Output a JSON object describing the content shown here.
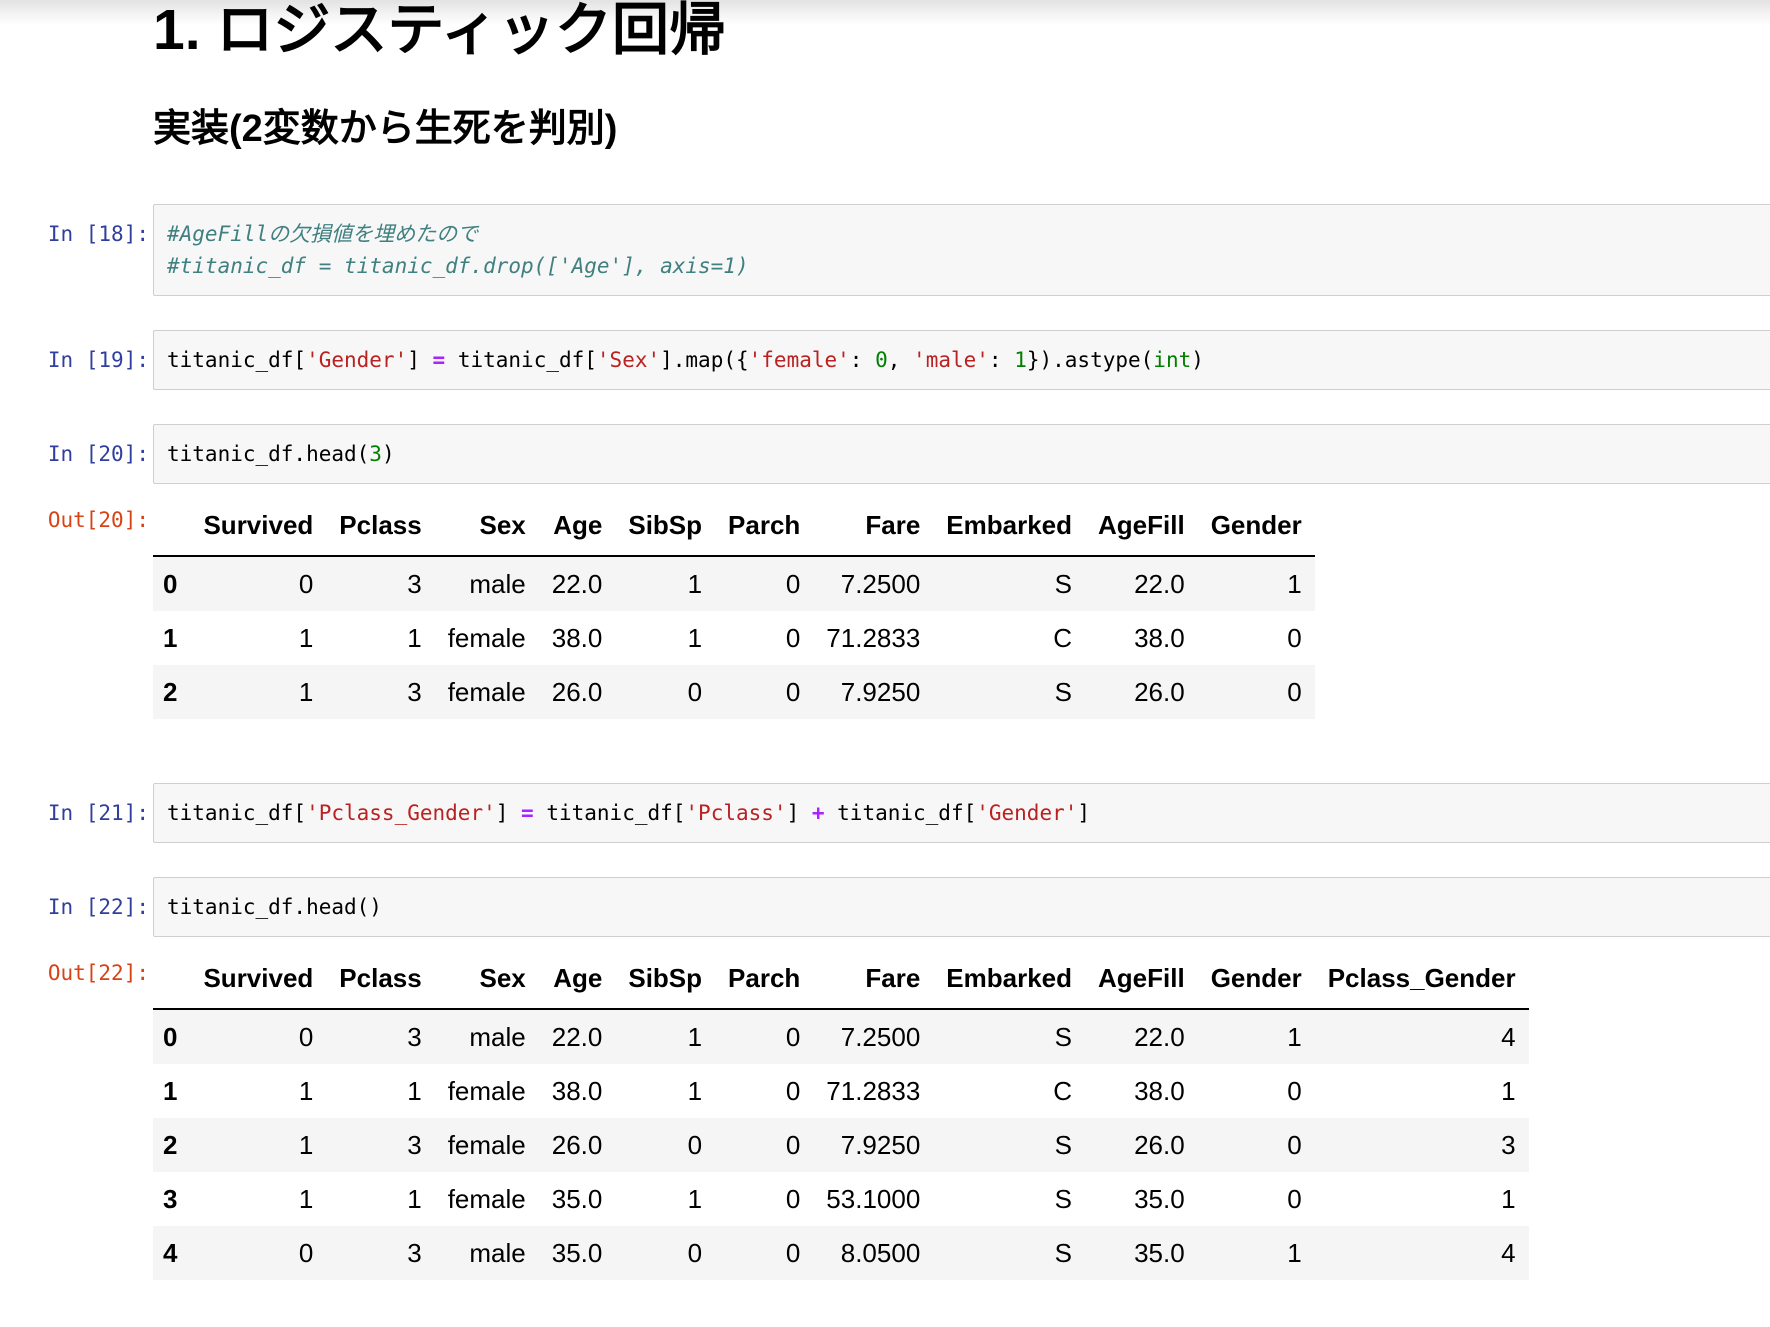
{
  "colors": {
    "input_prompt": "#303F9F",
    "output_prompt": "#D84315",
    "code_string": "#BA2121",
    "code_number": "#008000",
    "code_operator": "#AA22FF",
    "code_comment": "#408080",
    "cell_background": "#f7f7f7",
    "cell_border": "#cfcfcf",
    "table_stripe": "#f5f5f5"
  },
  "heading": {
    "h1": "1. ロジスティック回帰",
    "h3": "実装(2変数から生死を判別)"
  },
  "cell18": {
    "prompt": "In [18]:",
    "lines": [
      [
        [
          "comment",
          "#AgeFillの欠損値を埋めたので"
        ]
      ],
      [
        [
          "comment",
          "#titanic_df = titanic_df.drop(['Age'], axis=1)"
        ]
      ]
    ]
  },
  "cell19": {
    "prompt": "In [19]:",
    "lines": [
      [
        [
          "plain",
          "titanic_df["
        ],
        [
          "string",
          "'Gender'"
        ],
        [
          "plain",
          "] "
        ],
        [
          "operator",
          "="
        ],
        [
          "plain",
          " titanic_df["
        ],
        [
          "string",
          "'Sex'"
        ],
        [
          "plain",
          "].map({"
        ],
        [
          "string",
          "'female'"
        ],
        [
          "plain",
          ": "
        ],
        [
          "number",
          "0"
        ],
        [
          "plain",
          ", "
        ],
        [
          "string",
          "'male'"
        ],
        [
          "plain",
          ": "
        ],
        [
          "number",
          "1"
        ],
        [
          "plain",
          "}).astype("
        ],
        [
          "builtin",
          "int"
        ],
        [
          "plain",
          ")"
        ]
      ]
    ]
  },
  "cell20": {
    "prompt": "In [20]:",
    "lines": [
      [
        [
          "plain",
          "titanic_df.head("
        ],
        [
          "number",
          "3"
        ],
        [
          "plain",
          ")"
        ]
      ]
    ]
  },
  "out20": {
    "prompt": "Out[20]:",
    "table": {
      "columns": [
        "Survived",
        "Pclass",
        "Sex",
        "Age",
        "SibSp",
        "Parch",
        "Fare",
        "Embarked",
        "AgeFill",
        "Gender"
      ],
      "rows": [
        [
          "0",
          "0",
          "3",
          "male",
          "22.0",
          "1",
          "0",
          "7.2500",
          "S",
          "22.0",
          "1"
        ],
        [
          "1",
          "1",
          "1",
          "female",
          "38.0",
          "1",
          "0",
          "71.2833",
          "C",
          "38.0",
          "0"
        ],
        [
          "2",
          "1",
          "3",
          "female",
          "26.0",
          "0",
          "0",
          "7.9250",
          "S",
          "26.0",
          "0"
        ]
      ]
    }
  },
  "cell21": {
    "prompt": "In [21]:",
    "lines": [
      [
        [
          "plain",
          "titanic_df["
        ],
        [
          "string",
          "'Pclass_Gender'"
        ],
        [
          "plain",
          "] "
        ],
        [
          "operator",
          "="
        ],
        [
          "plain",
          " titanic_df["
        ],
        [
          "string",
          "'Pclass'"
        ],
        [
          "plain",
          "] "
        ],
        [
          "operator",
          "+"
        ],
        [
          "plain",
          " titanic_df["
        ],
        [
          "string",
          "'Gender'"
        ],
        [
          "plain",
          "]"
        ]
      ]
    ]
  },
  "cell22": {
    "prompt": "In [22]:",
    "lines": [
      [
        [
          "plain",
          "titanic_df.head()"
        ]
      ]
    ]
  },
  "out22": {
    "prompt": "Out[22]:",
    "table": {
      "columns": [
        "Survived",
        "Pclass",
        "Sex",
        "Age",
        "SibSp",
        "Parch",
        "Fare",
        "Embarked",
        "AgeFill",
        "Gender",
        "Pclass_Gender"
      ],
      "rows": [
        [
          "0",
          "0",
          "3",
          "male",
          "22.0",
          "1",
          "0",
          "7.2500",
          "S",
          "22.0",
          "1",
          "4"
        ],
        [
          "1",
          "1",
          "1",
          "female",
          "38.0",
          "1",
          "0",
          "71.2833",
          "C",
          "38.0",
          "0",
          "1"
        ],
        [
          "2",
          "1",
          "3",
          "female",
          "26.0",
          "0",
          "0",
          "7.9250",
          "S",
          "26.0",
          "0",
          "3"
        ],
        [
          "3",
          "1",
          "1",
          "female",
          "35.0",
          "1",
          "0",
          "53.1000",
          "S",
          "35.0",
          "0",
          "1"
        ],
        [
          "4",
          "0",
          "3",
          "male",
          "35.0",
          "0",
          "0",
          "8.0500",
          "S",
          "35.0",
          "1",
          "4"
        ]
      ]
    }
  }
}
